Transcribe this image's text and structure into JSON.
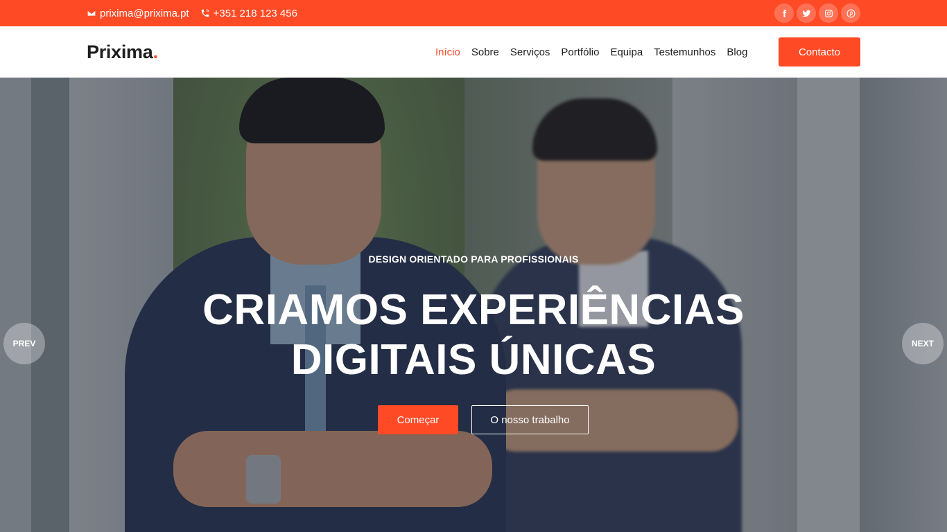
{
  "topbar": {
    "email": "prixima@prixima.pt",
    "phone": "+351 218 123 456",
    "social": [
      {
        "icon": "facebook-icon"
      },
      {
        "icon": "twitter-icon"
      },
      {
        "icon": "instagram-icon"
      },
      {
        "icon": "pinterest-icon"
      }
    ]
  },
  "header": {
    "logo_text": "Prixima",
    "logo_dot": ".",
    "nav": [
      {
        "label": "Início",
        "active": true
      },
      {
        "label": "Sobre",
        "active": false
      },
      {
        "label": "Serviços",
        "active": false
      },
      {
        "label": "Portfólio",
        "active": false
      },
      {
        "label": "Equipa",
        "active": false
      },
      {
        "label": "Testemunhos",
        "active": false
      },
      {
        "label": "Blog",
        "active": false
      }
    ],
    "cta_label": "Contacto"
  },
  "hero": {
    "subtitle": "DESIGN ORIENTADO PARA PROFISSIONAIS",
    "title_line1": "CRIAMOS EXPERIÊNCIAS",
    "title_line2": "DIGITAIS ÚNICAS",
    "primary_button": "Começar",
    "secondary_button": "O nosso trabalho",
    "prev_label": "PREV",
    "next_label": "NEXT"
  },
  "colors": {
    "accent": "#ff4a26",
    "text_dark": "#1d1d1d",
    "white": "#ffffff"
  }
}
